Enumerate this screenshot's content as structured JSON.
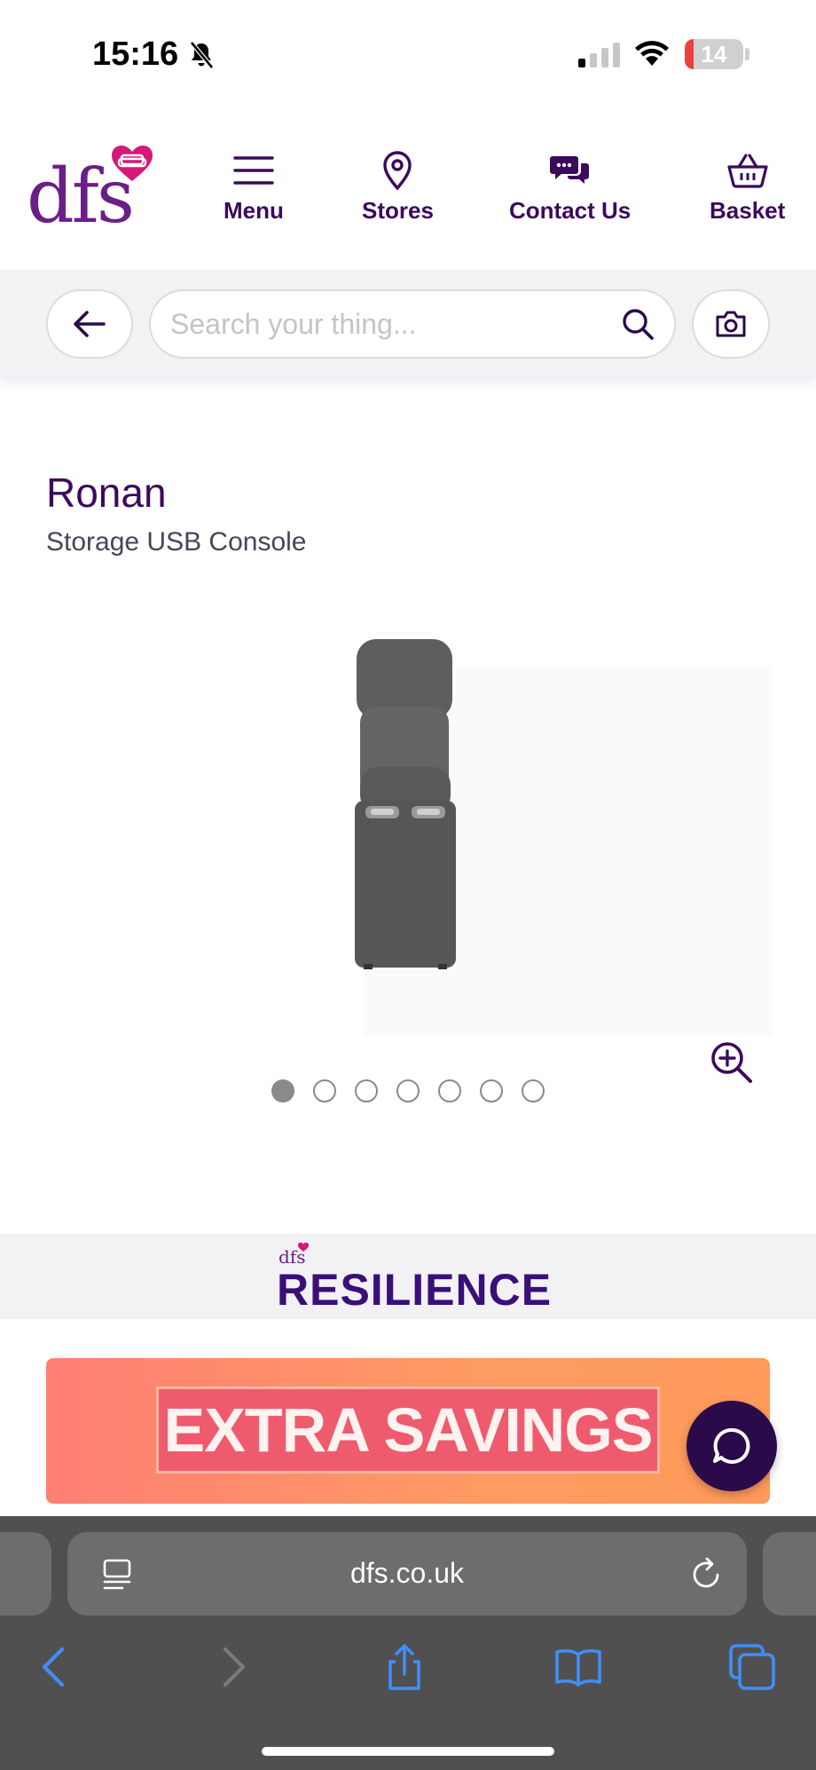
{
  "status_bar": {
    "time": "15:16",
    "battery_level": "14"
  },
  "header": {
    "logo_text": "dfs",
    "nav": [
      {
        "label": "Menu",
        "icon": "hamburger-icon"
      },
      {
        "label": "Stores",
        "icon": "map-pin-icon"
      },
      {
        "label": "Contact Us",
        "icon": "chat-bubbles-icon"
      },
      {
        "label": "Basket",
        "icon": "basket-icon"
      }
    ]
  },
  "search": {
    "placeholder": "Search your thing..."
  },
  "product": {
    "name": "Ronan",
    "subtitle": "Storage USB Console",
    "gallery_total": 7,
    "gallery_active": 1
  },
  "resilience": {
    "brand_small": "dfs",
    "title": "RESILIENCE"
  },
  "banner": {
    "text": "EXTRA SAVINGS"
  },
  "browser": {
    "url": "dfs.co.uk"
  },
  "colors": {
    "brand_purple": "#3b0a5c",
    "logo_purple": "#6a1f86",
    "heart_pink": "#d6187a",
    "banner_orange": "#ff9a62",
    "ios_blue": "#3f8ef7"
  }
}
